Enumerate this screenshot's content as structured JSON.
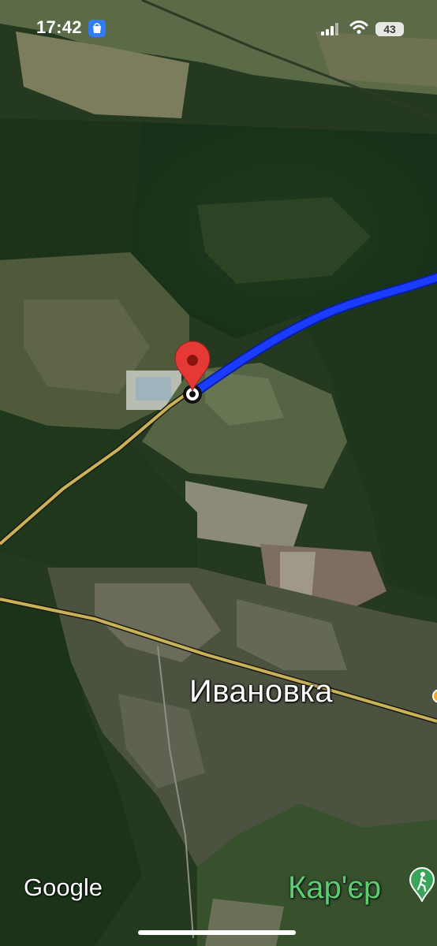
{
  "status_bar": {
    "time": "17:42",
    "battery": "43",
    "location_icon": "shop-bag-icon",
    "signal_icon": "cellular-signal-icon",
    "wifi_icon": "wifi-icon"
  },
  "map": {
    "view": "satellite",
    "place_labels": {
      "town": "Ивановка",
      "quarry": "Кар'єр"
    },
    "poi_icons": [
      "hiking-icon"
    ],
    "route_color": "#1a3cff",
    "marker_color": "#e53935",
    "attribution": "Google"
  }
}
